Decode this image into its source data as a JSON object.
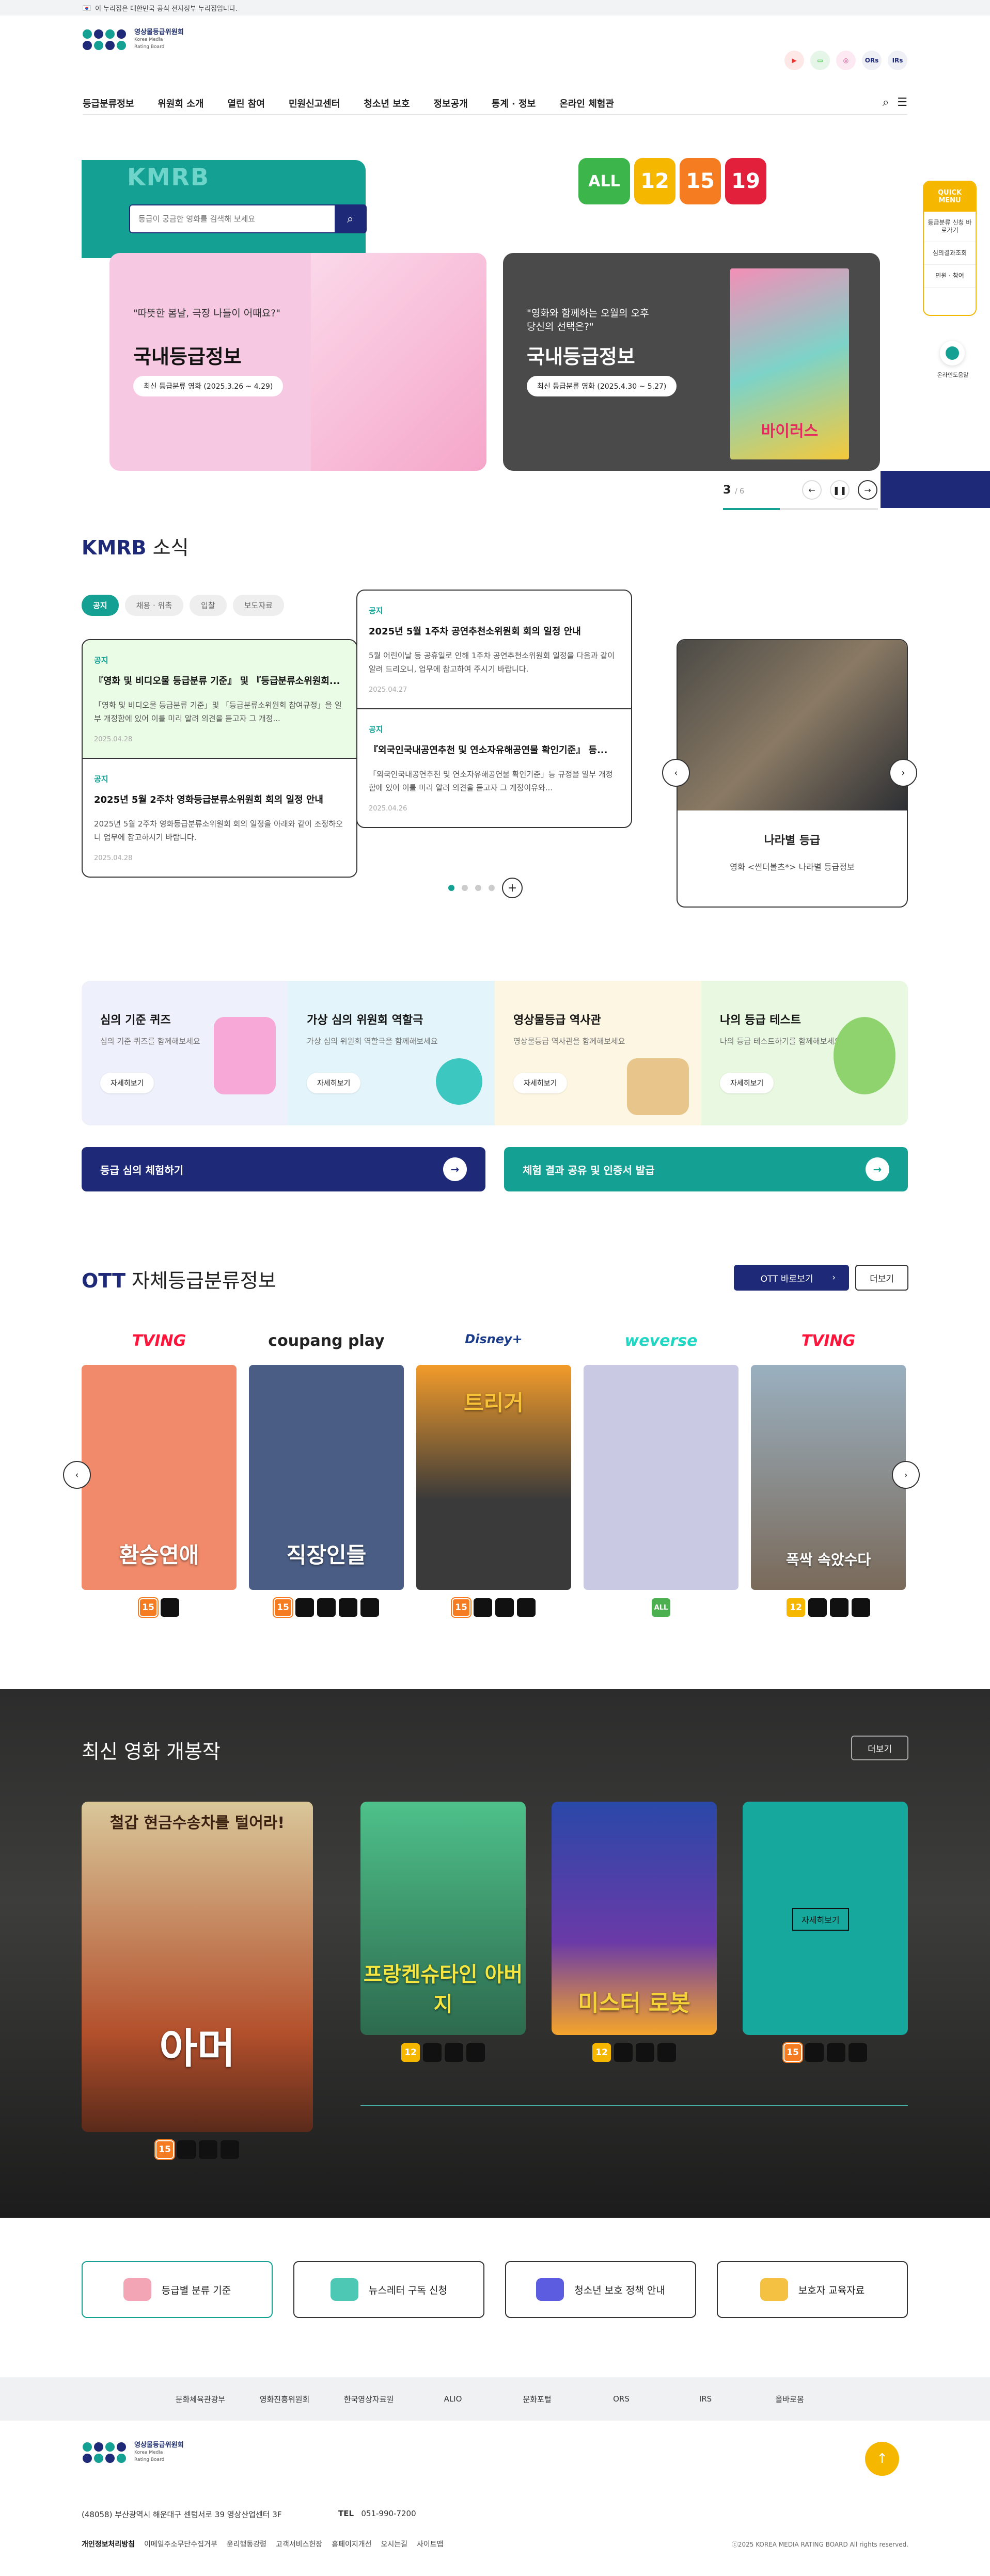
{
  "topbar": {
    "notice": "이 누리집은 대한민국 공식 전자정부 누리집입니다."
  },
  "logo": {
    "name": "영상물등급위원회",
    "en1": "Korea Media",
    "en2": "Rating Board"
  },
  "sns": [
    "youtube-icon",
    "chat-icon",
    "instagram-icon",
    "blog-icon"
  ],
  "sns_text": {
    "ors": "ORs",
    "irs": "IRs"
  },
  "nav": [
    "등급분류정보",
    "위원회 소개",
    "열린 참여",
    "민원신고센터",
    "청소년 보호",
    "정보공개",
    "통계 · 정보",
    "온라인 체험관"
  ],
  "hero": {
    "kmrb": "KMRB",
    "search_placeholder": "등급이 궁금한 영화를 검색해 보세요",
    "card1": {
      "q": "\"따뜻한 봄날, 극장 나들이 어때요?\"",
      "title": "국내등급정보",
      "pill": "최신 등급분류 영화 (2025.3.26 ~ 4.29)"
    },
    "card2": {
      "q1": "\"영화와 함께하는 오월의 오후",
      "q2": "당신의 선택은?\"",
      "title": "국내등급정보",
      "pill": "최신 등급분류 영화 (2025.4.30 ~ 5.27)"
    },
    "poster_title": "바이러스",
    "badges": [
      "ALL",
      "12",
      "15",
      "19"
    ],
    "slide_current": "3",
    "slide_total": "/ 6"
  },
  "quick": {
    "title1": "QUICK",
    "title2": "MENU",
    "items": [
      "등급분류 신청 바로가기",
      "심의결과조회",
      "민원 · 참여"
    ]
  },
  "chat": {
    "label": "온라인도움말"
  },
  "news": {
    "title_b": "KMRB",
    "title": " 소식",
    "tabs": [
      "공지",
      "채용 · 위촉",
      "입찰",
      "보도자료"
    ],
    "col1": [
      {
        "cat": "공지",
        "title": "『영화 및 비디오물 등급분류 기준』 및 『등급분류소위원회...",
        "desc": "「영화 및 비디오물 등급분류 기준」및 「등급분류소위원회 참여규정」을 일부 개정함에 있어 이를 미리 알려 의견을 듣고자 그 개정...",
        "date": "2025.04.28"
      },
      {
        "cat": "공지",
        "title": "2025년 5월 2주차 영화등급분류소위원회 회의 일정 안내",
        "desc": "2025년 5월 2주차 영화등급분류소위원회 회의 일정을 아래와 같이 조정하오니 업무에 참고하시기 바랍니다.",
        "date": "2025.04.28"
      }
    ],
    "col2": [
      {
        "cat": "공지",
        "title": "2025년 5월 1주차 공연추천소위원회 회의 일정 안내",
        "desc": "5월 어린이날 등 공휴일로 인해 1주차 공연추천소위원회 일정을 다음과 같이 알려 드리오니, 업무에 참고하여 주시기 바랍니다.",
        "date": "2025.04.27"
      },
      {
        "cat": "공지",
        "title": "『외국인국내공연추천 및 연소자유해공연물 확인기준』 등...",
        "desc": "「외국인국내공연추천 및 연소자유해공연물 확인기준」등 규정을 일부 개정함에 있어 이를 미리 알려 의견을 듣고자 그 개정이유와...",
        "date": "2025.04.26"
      }
    ],
    "promo": {
      "name": "나라별 등급",
      "desc": "영화 <썬더볼츠*> 나라별 등급정보"
    }
  },
  "experience": [
    {
      "title": "심의 기준 퀴즈",
      "desc": "심의 기준 퀴즈를 함께해보세요",
      "more": "자세히보기",
      "bg": "#eef0fb",
      "ill": "#f7a8d6"
    },
    {
      "title": "가상 심의 위원회 역할극",
      "desc": "가상 심의 위원회 역할극을 함께해보세요",
      "more": "자세히보기",
      "bg": "#e3f5fb",
      "ill": "#3cc7c1"
    },
    {
      "title": "영상물등급 역사관",
      "desc": "영상물등급 역사관을 함께해보세요",
      "more": "자세히보기",
      "bg": "#fdf6e2",
      "ill": "#e8c58a"
    },
    {
      "title": "나의 등급 테스트",
      "desc": "나의 등급 테스트하기를 함께해보세요",
      "more": "자세히보기",
      "bg": "#e9f9e1",
      "ill": "#8fd36f"
    }
  ],
  "wide_buttons": {
    "left": "등급 심의 체험하기",
    "right": "체험 결과 공유 및 인증서 발급"
  },
  "ott": {
    "title_b": "OTT",
    "title": " 자체등급분류정보",
    "btn_go": "OTT 바로보기",
    "btn_more": "더보기",
    "cards": [
      {
        "brand": "TVING",
        "brand_color": "#ff153c",
        "poster_title": "환승연애",
        "poster_color": "#f08a6a",
        "rating": "15"
      },
      {
        "brand": "coupang play",
        "brand_color": "#222222",
        "poster_title": "직장인들",
        "poster_color": "#4a5d84",
        "rating": "15"
      },
      {
        "brand": "Disney+",
        "brand_color": "#1a3a8a",
        "poster_title": "트리거",
        "poster_color": "#3a3a3a",
        "rating": "15"
      },
      {
        "brand": "weverse",
        "brand_color": "#1fd6c2",
        "poster_title": "",
        "poster_color": "#c9c9e4",
        "rating": "ALL"
      },
      {
        "brand": "TVING",
        "brand_color": "#ff153c",
        "poster_title": "폭싹 속았수다",
        "poster_color": "#9a8a7a",
        "rating": "12"
      }
    ]
  },
  "movies": {
    "title": "최신 영화 개봉작",
    "more": "더보기",
    "cards": [
      {
        "title": "아머",
        "top": "철갑 현금수송차를 털어라!",
        "color": "#b3502c",
        "rating": "15"
      },
      {
        "title": "프랑켄슈타인 아버지",
        "top": "",
        "color": "#3aa46c",
        "rating": "12"
      },
      {
        "title": "미스터 로봇",
        "top": "",
        "color": "#2a48a8",
        "rating": "12"
      },
      {
        "title": "",
        "top": "",
        "color": "#16a89c",
        "rating": "15",
        "hover": "자세히보기"
      }
    ]
  },
  "quicklinks": [
    {
      "label": "등급별 분류 기준",
      "color": "#f3a5b5"
    },
    {
      "label": "뉴스레터 구독 신청",
      "color": "#4cc8b5"
    },
    {
      "label": "청소년 보호 정책 안내",
      "color": "#5b5ce0"
    },
    {
      "label": "보호자 교육자료",
      "color": "#f5c142"
    }
  ],
  "institutions": [
    "문화체육관광부",
    "영화진흥위원회",
    "한국영상자료원",
    "ALIO",
    "문화포털",
    "ORS",
    "IRS",
    "올바로봄"
  ],
  "footer": {
    "address": "(48058) 부산광역시 해운대구 센텀서로 39 영상산업센터 3F",
    "tel_label": "TEL",
    "tel": "051-990-7200",
    "links": [
      "개인정보처리방침",
      "이메일주소무단수집거부",
      "윤리행동강령",
      "고객서비스헌장",
      "홈페이지개선",
      "오시는길",
      "사이트맵"
    ],
    "copyright": "ⓒ2025 KOREA MEDIA RATING BOARD All rights reserved."
  }
}
